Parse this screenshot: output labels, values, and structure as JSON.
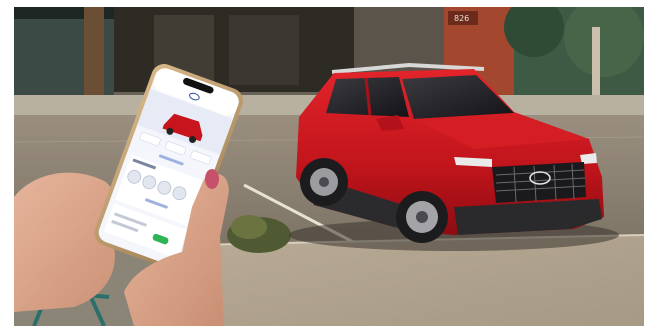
{
  "image": {
    "kind": "photograph",
    "colors": {
      "car_body": "#c8141c",
      "phone_screen": "#f4f6fb",
      "phone_accent": "#2f5bd0",
      "button_green": "#2fb455",
      "asphalt": "#8c8272",
      "sidewalk": "#b4a691"
    }
  },
  "scene": {
    "building_number": "826",
    "car_grille_logo": "hyundai-logo"
  },
  "phone": {
    "app_logo": "hyundai-logo"
  }
}
